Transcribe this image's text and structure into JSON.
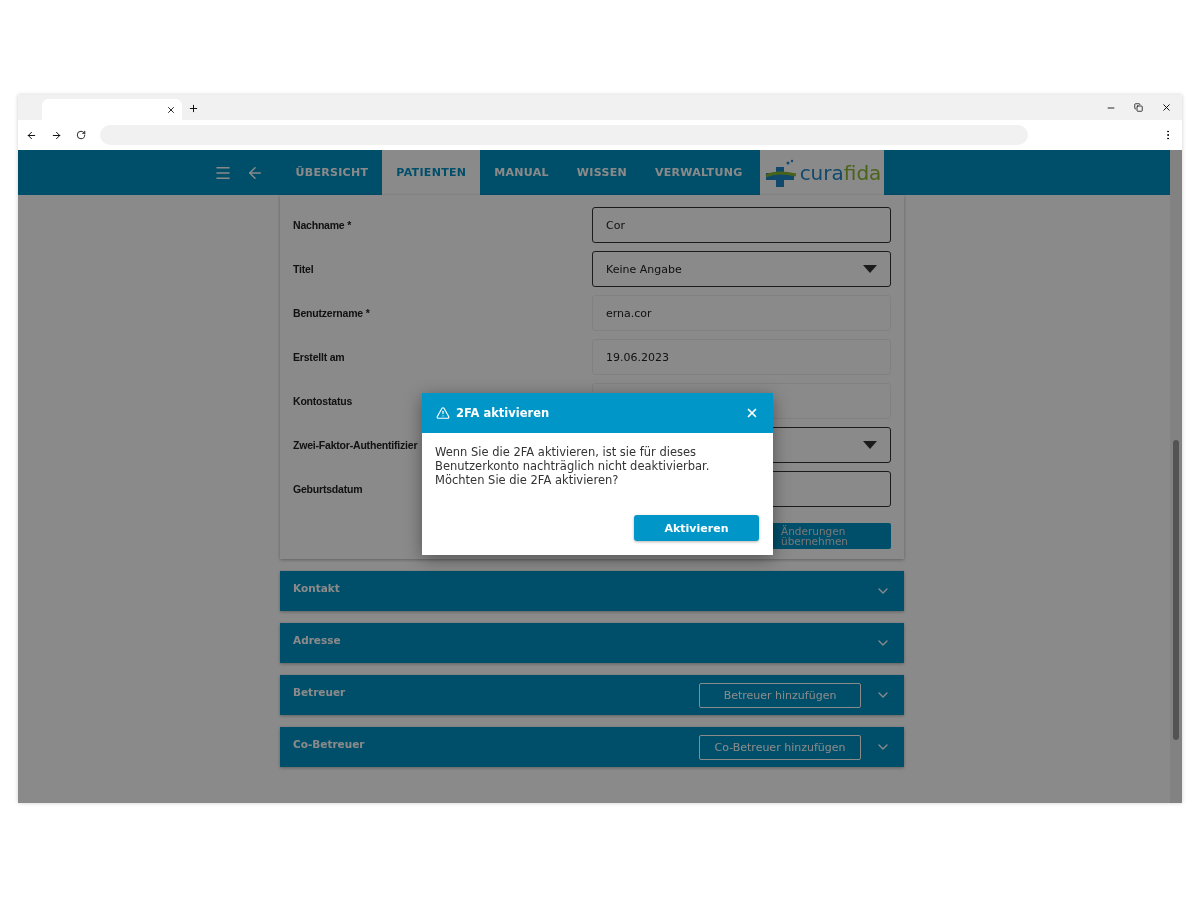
{
  "nav": {
    "items": [
      {
        "label": "ÜBERSICHT",
        "selected": false
      },
      {
        "label": "PATIENTEN",
        "selected": true
      },
      {
        "label": "MANUAL",
        "selected": false
      },
      {
        "label": "WISSEN",
        "selected": false
      },
      {
        "label": "VERWALTUNG",
        "selected": false
      }
    ],
    "logo": {
      "first": "cura",
      "second": "fida"
    }
  },
  "form": {
    "rows": [
      {
        "label": "Nachname *",
        "kind": "input",
        "value": "Cor"
      },
      {
        "label": "Titel",
        "kind": "select",
        "value": "Keine Angabe"
      },
      {
        "label": "Benutzername *",
        "kind": "readonly",
        "value": "erna.cor"
      },
      {
        "label": "Erstellt am",
        "kind": "readonly",
        "value": "19.06.2023"
      },
      {
        "label": "Kontostatus",
        "kind": "readonly"
      },
      {
        "label": "Zwei-Faktor-Authentifizier",
        "kind": "select"
      },
      {
        "label": "Geburtsdatum",
        "kind": "input"
      }
    ],
    "save_button": "Änderungen übernehmen"
  },
  "sections": [
    {
      "title": "Kontakt"
    },
    {
      "title": "Adresse"
    },
    {
      "title": "Betreuer",
      "action": "Betreuer hinzufügen"
    },
    {
      "title": "Co-Betreuer",
      "action": "Co-Betreuer hinzufügen"
    }
  ],
  "dialog": {
    "title": "2FA aktivieren",
    "message": "Wenn Sie die 2FA aktivieren, ist sie für dieses Benutzerkonto nachträglich nicht deaktivierbar. Möchten Sie die 2FA aktivieren?",
    "confirm": "Aktivieren"
  }
}
